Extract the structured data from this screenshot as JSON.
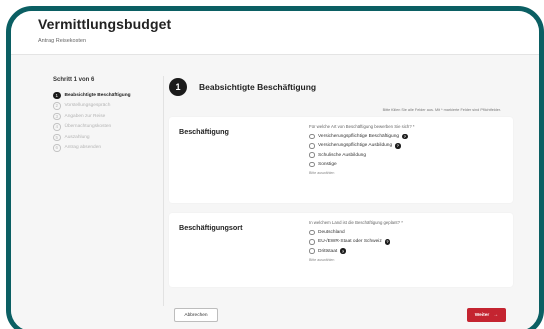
{
  "page": {
    "title": "Vermittlungsbudget",
    "subtitle": "Antrag Reisekosten"
  },
  "sidebar": {
    "step_count": "Schritt 1 von 6",
    "steps": [
      {
        "num": "1",
        "label": "Beabsichtigte Beschäftigung",
        "active": true
      },
      {
        "num": "2",
        "label": "Vorstellungsgespräch",
        "active": false
      },
      {
        "num": "3",
        "label": "Angaben zur Reise",
        "active": false
      },
      {
        "num": "4",
        "label": "Übernachtungskosten",
        "active": false
      },
      {
        "num": "5",
        "label": "Auszahlung",
        "active": false
      },
      {
        "num": "6",
        "label": "Antrag absenden",
        "active": false
      }
    ]
  },
  "section": {
    "number": "1",
    "title": "Beabsichtigte Beschäftigung",
    "required_note": "Bitte füllen Sie alle Felder aus. Mit * markierte Felder sind Pflichtfelder."
  },
  "employment": {
    "label": "Beschäftigung",
    "question": "Für welche Art von Beschäftigung bewerben Sie sich? *",
    "options": [
      {
        "label": "Versicherungspflichtige Beschäftigung",
        "info": true
      },
      {
        "label": "Versicherungspflichtige Ausbildung",
        "info": true
      },
      {
        "label": "Schulische Ausbildung",
        "info": false
      },
      {
        "label": "Sonstige",
        "info": false
      }
    ],
    "hint": "Bitte auswählen"
  },
  "location": {
    "label": "Beschäftigungsort",
    "question": "In welchem Land ist die Beschäftigung geplant? *",
    "options": [
      {
        "label": "Deutschland",
        "info": false
      },
      {
        "label": "EU-/EWR-Staat oder Schweiz",
        "info": true
      },
      {
        "label": "Drittstaat",
        "info": true
      }
    ],
    "hint": "Bitte auswählen"
  },
  "actions": {
    "cancel": "Abbrechen",
    "next": "Weiter",
    "next_arrow": "→"
  },
  "icons": {
    "info_glyph": "?"
  },
  "colors": {
    "frame": "#0b5f63",
    "primary_button": "#c42430",
    "active_step": "#1b1b1b"
  }
}
